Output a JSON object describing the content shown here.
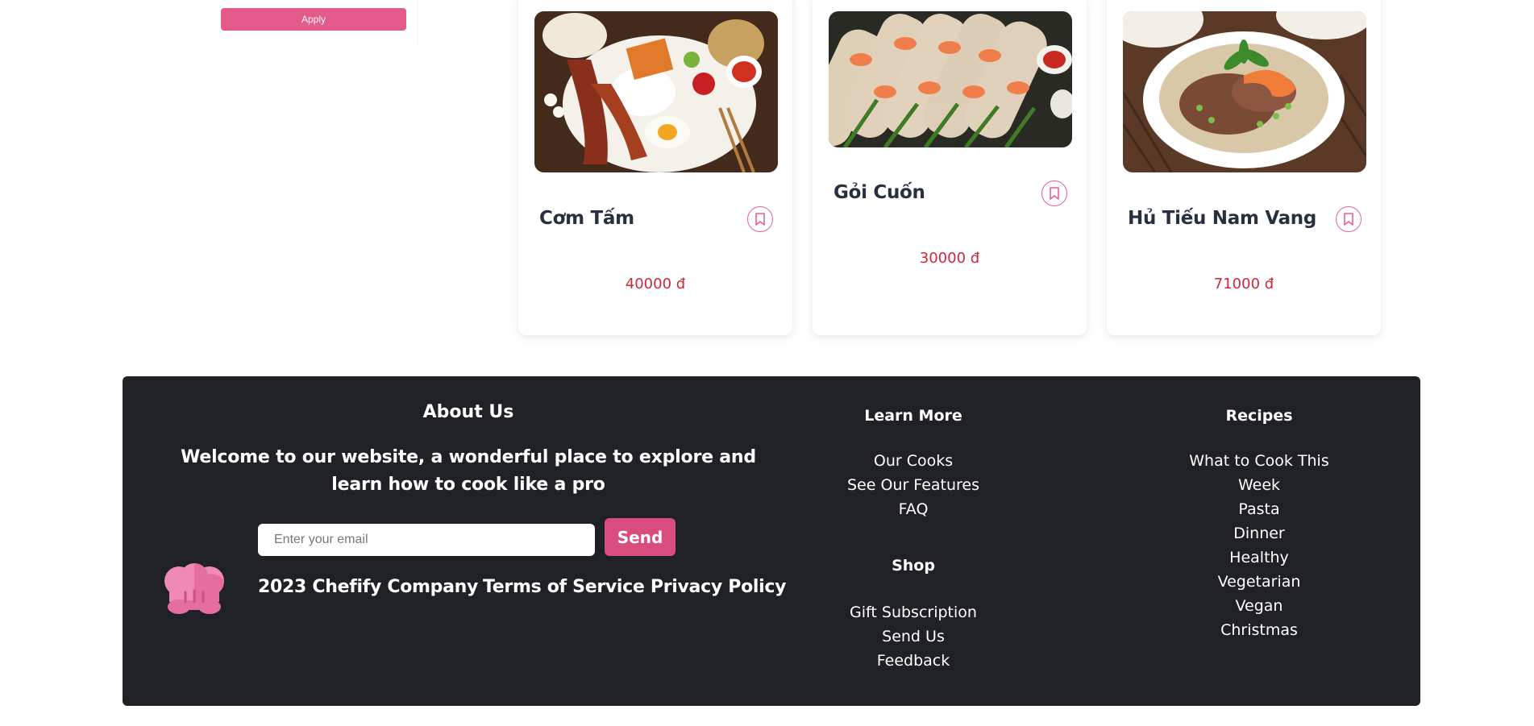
{
  "filter": {
    "apply_label": "Apply"
  },
  "recipes": [
    {
      "name": "Cơm Tấm",
      "price": "40000 đ"
    },
    {
      "name": "Gỏi Cuốn",
      "price": "30000 đ"
    },
    {
      "name": "Hủ Tiếu Nam Vang",
      "price": "71000 đ"
    }
  ],
  "footer": {
    "about_title": "About Us",
    "about_text": "Welcome to our website, a wonderful place to explore and learn how to cook like a pro",
    "email_placeholder": "Enter your email",
    "send_label": "Send",
    "copyright": "2023 Chefify Company",
    "terms": "Terms of Service Privacy Policy",
    "learn_more": {
      "title": "Learn More",
      "links": [
        "Our Cooks",
        "See Our Features",
        "FAQ"
      ]
    },
    "shop": {
      "title": "Shop",
      "links": [
        "Gift Subscription",
        "Send Us",
        "Feedback"
      ]
    },
    "recipes": {
      "title": "Recipes",
      "links": [
        "What to Cook This",
        "Week",
        "Pasta",
        "Dinner",
        "Healthy",
        "Vegetarian",
        "Vegan",
        "Christmas"
      ]
    }
  },
  "colors": {
    "accent": "#e45a8a",
    "price": "#d0263a",
    "footer_bg": "#1f2125",
    "title": "#263040"
  },
  "icons": {
    "bookmark": "bookmark-icon",
    "logo": "chef-hat-icon"
  }
}
